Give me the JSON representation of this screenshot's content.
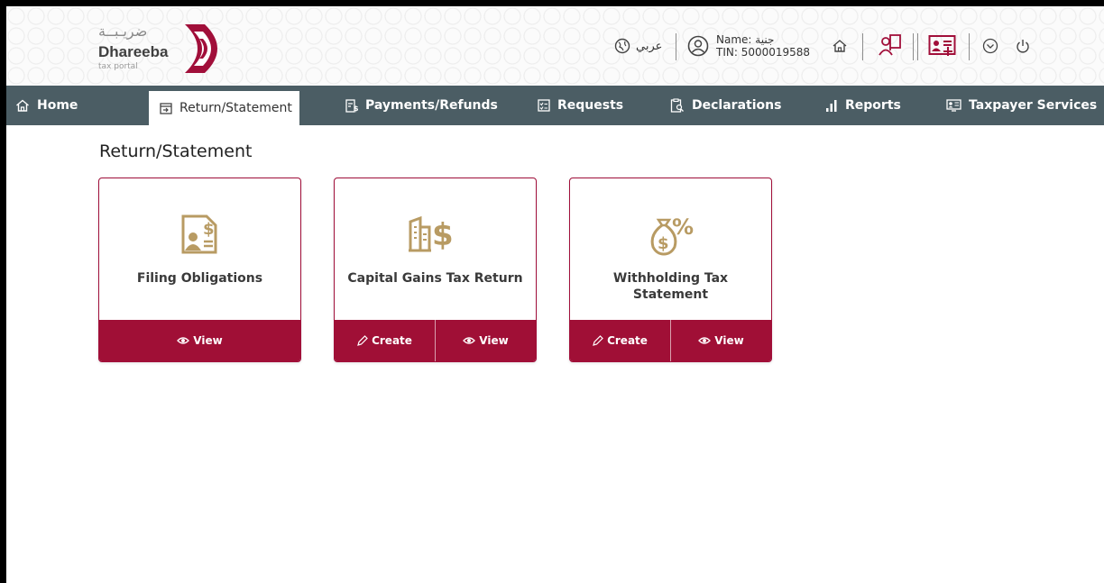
{
  "header": {
    "logo": {
      "arabic": "ضريـبــة",
      "english": "Dhareeba",
      "subtitle": "tax portal"
    },
    "language_label": "عربي",
    "user": {
      "name_line": "Name: جنية",
      "tin_line": "TIN: 5000019588"
    },
    "icons": [
      "globe-icon",
      "user-circle-icon",
      "home-icon",
      "book-user-icon",
      "add-card-icon",
      "chevron-down-circle-icon",
      "power-icon"
    ]
  },
  "nav": {
    "items": [
      {
        "label": "Home",
        "icon": "home-icon"
      },
      {
        "label": "Return/Statement",
        "icon": "calendar-arrow-icon",
        "active": true
      },
      {
        "label": "Payments/Refunds",
        "icon": "payments-doc-icon"
      },
      {
        "label": "Requests",
        "icon": "checklist-icon"
      },
      {
        "label": "Declarations",
        "icon": "clipboard-search-icon"
      },
      {
        "label": "Reports",
        "icon": "bar-chart-icon"
      },
      {
        "label": "Taxpayer Services",
        "icon": "id-card-icon"
      }
    ]
  },
  "page": {
    "title": "Return/Statement"
  },
  "cards": [
    {
      "title": "Filing Obligations",
      "icon": "filing-doc-icon",
      "actions": [
        "View"
      ]
    },
    {
      "title": "Capital Gains Tax Return",
      "icon": "building-dollar-icon",
      "actions": [
        "Create",
        "View"
      ]
    },
    {
      "title": "Withholding Tax Statement",
      "icon": "money-bag-percent-icon",
      "actions": [
        "Create",
        "View"
      ]
    }
  ],
  "colors": {
    "brand": "#a00f36",
    "nav_bg": "#4b5d64",
    "gold": "#b89b63"
  }
}
